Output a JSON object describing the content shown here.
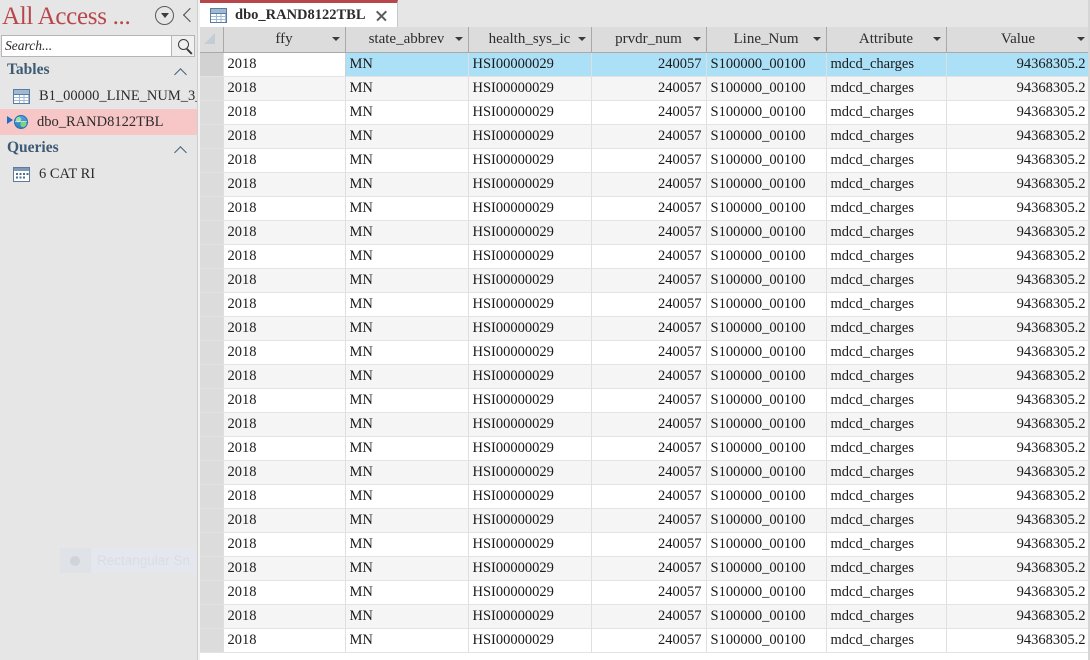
{
  "nav_pane": {
    "title": "All Access ...",
    "dropdown_icon": "circle-chevron-down-icon",
    "collapse_icon": "chevron-left-icon",
    "search": {
      "placeholder": "Search...",
      "value": "",
      "button_icon": "search-icon"
    },
    "groups": [
      {
        "label": "Tables",
        "chevron": "chevron-up-icon",
        "items": [
          {
            "label": "B1_00000_LINE_NUM_3_...",
            "icon": "table-icon",
            "selected": false
          },
          {
            "label": "dbo_RAND8122TBL",
            "icon": "linked-table-globe-icon",
            "selected": true
          }
        ]
      },
      {
        "label": "Queries",
        "chevron": "chevron-up-icon",
        "items": [
          {
            "label": "6 CAT RI",
            "icon": "query-icon",
            "selected": false
          }
        ]
      }
    ],
    "watermark_text": "Rectangular Sn"
  },
  "tab_strip": {
    "tabs": [
      {
        "label": "dbo_RAND8122TBL",
        "icon": "table-icon",
        "active": true,
        "close_icon": "close-icon"
      }
    ]
  },
  "datasheet": {
    "select_all_corner": "select-all-triangle-icon",
    "columns": [
      {
        "key": "ffy",
        "label": "ffy",
        "align": "left",
        "caret": "chevron-down-icon"
      },
      {
        "key": "state_abbrev",
        "label": "state_abbrev",
        "align": "left",
        "caret": "chevron-down-icon"
      },
      {
        "key": "health_sys_id",
        "label": "health_sys_ic",
        "align": "left",
        "caret": "chevron-down-icon"
      },
      {
        "key": "prvdr_num",
        "label": "prvdr_num",
        "align": "right",
        "caret": "chevron-down-icon"
      },
      {
        "key": "Line_Num",
        "label": "Line_Num",
        "align": "left",
        "caret": "chevron-down-icon"
      },
      {
        "key": "Attribute",
        "label": "Attribute",
        "align": "left",
        "caret": "chevron-down-icon"
      },
      {
        "key": "Value",
        "label": "Value",
        "align": "right",
        "caret": "chevron-down-icon"
      }
    ],
    "row_template": {
      "ffy": "2018",
      "state_abbrev": "MN",
      "health_sys_id": "HSI00000029",
      "prvdr_num": "240057",
      "Line_Num": "S100000_00100",
      "Attribute": "mdcd_charges",
      "Value": "94368305.2"
    },
    "row_count": 25,
    "selected_row_index": 0,
    "active_cell_column": "ffy",
    "colors": {
      "selection": "#ace0f7",
      "header": "#dcdcdc",
      "row_alt": "#f5f5f5",
      "accent": "#b8474b",
      "nav_selected": "#f7c6c7",
      "group_label": "#3f5a74"
    }
  }
}
